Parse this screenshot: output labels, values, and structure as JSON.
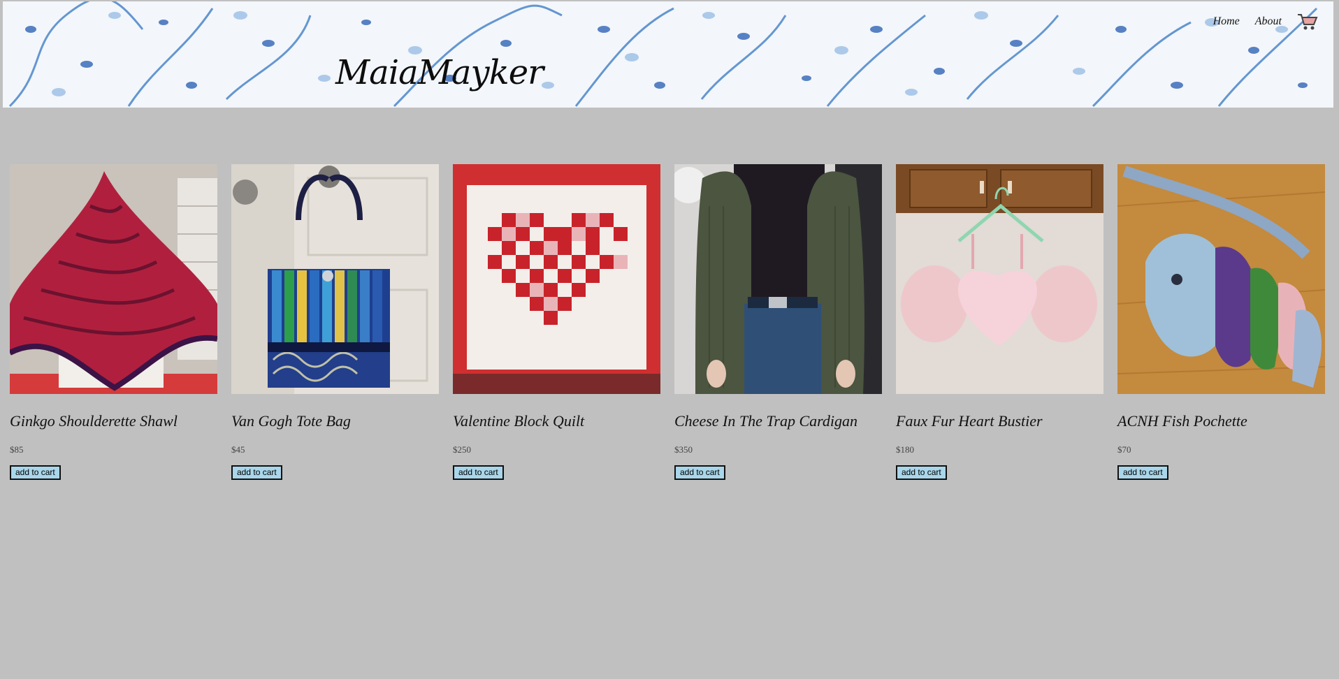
{
  "header": {
    "brand": "MaiaMayker",
    "nav": [
      {
        "label": "Home"
      },
      {
        "label": "About"
      }
    ],
    "cart_icon": "shopping-cart-icon",
    "background": "blue-watercolor-leaf-pattern"
  },
  "products": [
    {
      "title": "Ginkgo Shoulderette Shawl",
      "price": "$85",
      "button": "add to cart",
      "image": "red-knit-shawl-photo"
    },
    {
      "title": "Van Gogh Tote Bag",
      "price": "$45",
      "button": "add to cart",
      "image": "blue-tote-bag-photo"
    },
    {
      "title": "Valentine Block Quilt",
      "price": "$250",
      "button": "add to cart",
      "image": "heart-quilt-photo"
    },
    {
      "title": "Cheese In The Trap Cardigan",
      "price": "$350",
      "button": "add to cart",
      "image": "green-cardigan-photo"
    },
    {
      "title": "Faux Fur Heart Bustier",
      "price": "$180",
      "button": "add to cart",
      "image": "pink-fur-bustier-photo"
    },
    {
      "title": "ACNH Fish Pochette",
      "price": "$70",
      "button": "add to cart",
      "image": "fish-pochette-photo"
    }
  ],
  "colors": {
    "page_background": "#c0c0c0",
    "button_background": "#a9d6ea",
    "header_accent": "#3a73c4"
  }
}
